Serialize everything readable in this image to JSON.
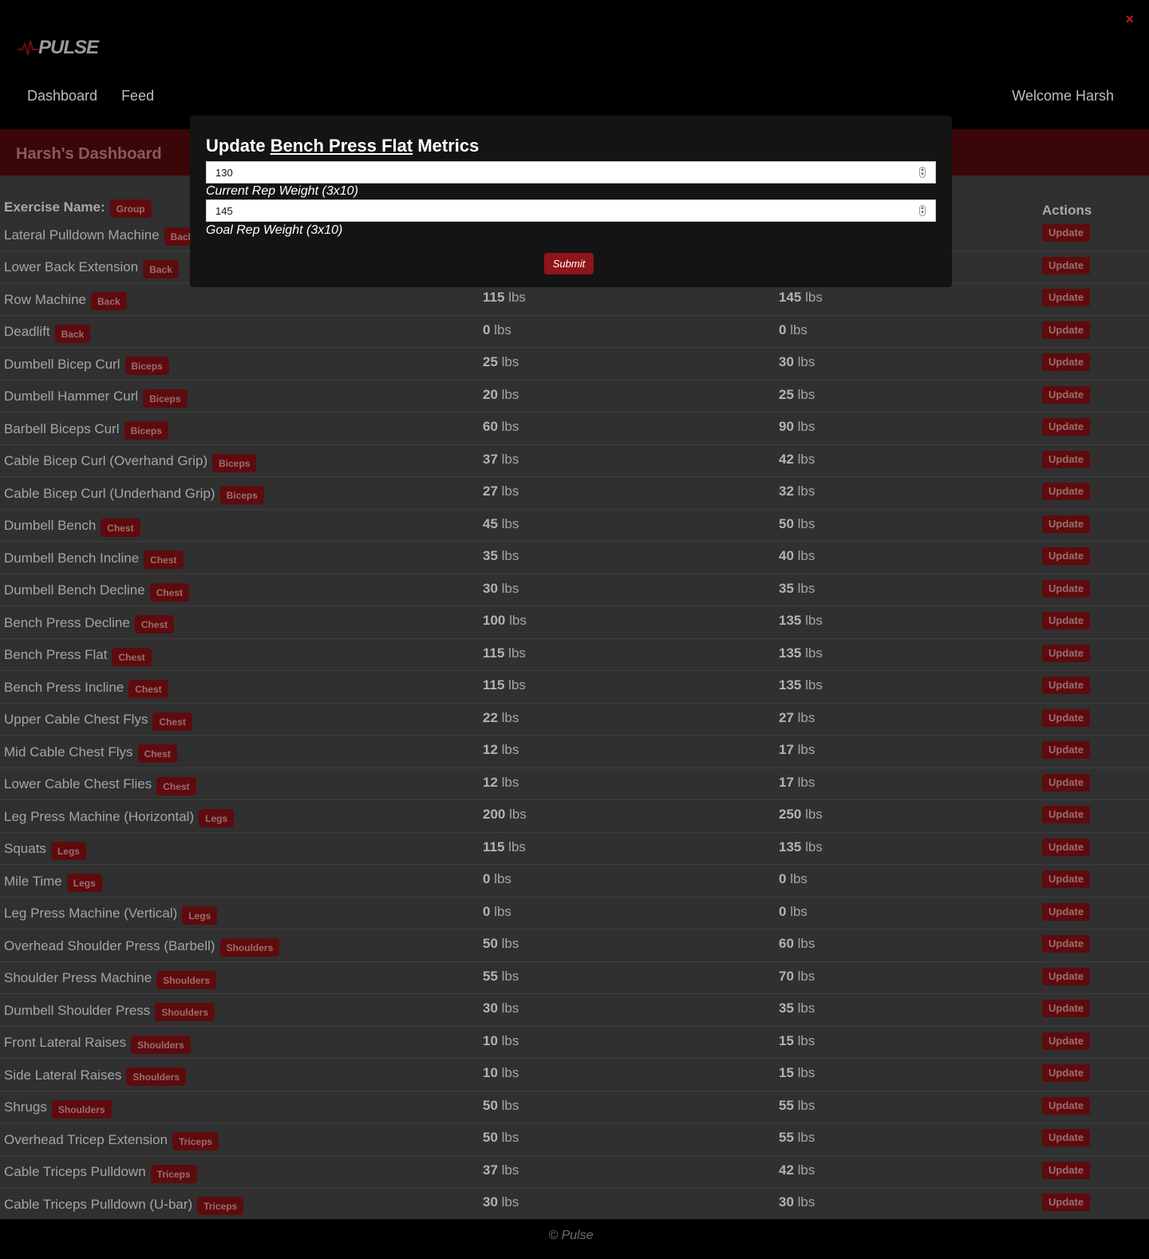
{
  "app": {
    "logo_text": "PULSE",
    "nav": [
      "Dashboard",
      "Feed"
    ],
    "welcome": "Welcome Harsh",
    "close_glyph": "×",
    "footer": "© Pulse"
  },
  "dashboard": {
    "title": "Harsh's Dashboard",
    "header_name": "Exercise Name:",
    "header_group": "Group",
    "header_actions": "Actions",
    "update_label": "Update",
    "rows": [
      {
        "name": "Lateral Pulldown Machine",
        "group": "Back",
        "current": "",
        "goal": ""
      },
      {
        "name": "Lower Back Extension",
        "group": "Back",
        "current": "",
        "goal": ""
      },
      {
        "name": "Row Machine",
        "group": "Back",
        "current": "115",
        "goal": "145"
      },
      {
        "name": "Deadlift",
        "group": "Back",
        "current": "0",
        "goal": "0"
      },
      {
        "name": "Dumbell Bicep Curl",
        "group": "Biceps",
        "current": "25",
        "goal": "30"
      },
      {
        "name": "Dumbell Hammer Curl",
        "group": "Biceps",
        "current": "20",
        "goal": "25"
      },
      {
        "name": "Barbell Biceps Curl",
        "group": "Biceps",
        "current": "60",
        "goal": "90"
      },
      {
        "name": "Cable Bicep Curl (Overhand Grip)",
        "group": "Biceps",
        "current": "37",
        "goal": "42"
      },
      {
        "name": "Cable Bicep Curl (Underhand Grip)",
        "group": "Biceps",
        "current": "27",
        "goal": "32"
      },
      {
        "name": "Dumbell Bench",
        "group": "Chest",
        "current": "45",
        "goal": "50"
      },
      {
        "name": "Dumbell Bench Incline",
        "group": "Chest",
        "current": "35",
        "goal": "40"
      },
      {
        "name": "Dumbell Bench Decline",
        "group": "Chest",
        "current": "30",
        "goal": "35"
      },
      {
        "name": "Bench Press Decline",
        "group": "Chest",
        "current": "100",
        "goal": "135"
      },
      {
        "name": "Bench Press Flat",
        "group": "Chest",
        "current": "115",
        "goal": "135"
      },
      {
        "name": "Bench Press Incline",
        "group": "Chest",
        "current": "115",
        "goal": "135"
      },
      {
        "name": "Upper Cable Chest Flys",
        "group": "Chest",
        "current": "22",
        "goal": "27"
      },
      {
        "name": "Mid Cable Chest Flys",
        "group": "Chest",
        "current": "12",
        "goal": "17"
      },
      {
        "name": "Lower Cable Chest Flies",
        "group": "Chest",
        "current": "12",
        "goal": "17"
      },
      {
        "name": "Leg Press Machine (Horizontal)",
        "group": "Legs",
        "current": "200",
        "goal": "250"
      },
      {
        "name": "Squats",
        "group": "Legs",
        "current": "115",
        "goal": "135"
      },
      {
        "name": "Mile Time",
        "group": "Legs",
        "current": "0",
        "goal": "0"
      },
      {
        "name": "Leg Press Machine (Vertical)",
        "group": "Legs",
        "current": "0",
        "goal": "0"
      },
      {
        "name": "Overhead Shoulder Press (Barbell)",
        "group": "Shoulders",
        "current": "50",
        "goal": "60"
      },
      {
        "name": "Shoulder Press Machine",
        "group": "Shoulders",
        "current": "55",
        "goal": "70"
      },
      {
        "name": "Dumbell Shoulder Press",
        "group": "Shoulders",
        "current": "30",
        "goal": "35"
      },
      {
        "name": "Front Lateral Raises",
        "group": "Shoulders",
        "current": "10",
        "goal": "15"
      },
      {
        "name": "Side Lateral Raises",
        "group": "Shoulders",
        "current": "10",
        "goal": "15"
      },
      {
        "name": "Shrugs",
        "group": "Shoulders",
        "current": "50",
        "goal": "55"
      },
      {
        "name": "Overhead Tricep Extension",
        "group": "Triceps",
        "current": "50",
        "goal": "55"
      },
      {
        "name": "Cable Triceps Pulldown",
        "group": "Triceps",
        "current": "37",
        "goal": "42"
      },
      {
        "name": "Cable Triceps Pulldown (U-bar)",
        "group": "Triceps",
        "current": "30",
        "goal": "30"
      }
    ],
    "unit": "lbs"
  },
  "modal": {
    "title_prefix": "Update",
    "exercise": "Bench Press Flat",
    "title_suffix": "Metrics",
    "current_value": "130",
    "current_label": "Current Rep Weight (3x10)",
    "goal_value": "145",
    "goal_label": "Goal Rep Weight (3x10)",
    "submit_label": "Submit"
  },
  "colors": {
    "accent": "#8f151a",
    "badge": "#5e0b0e",
    "close": "#c4171c"
  }
}
